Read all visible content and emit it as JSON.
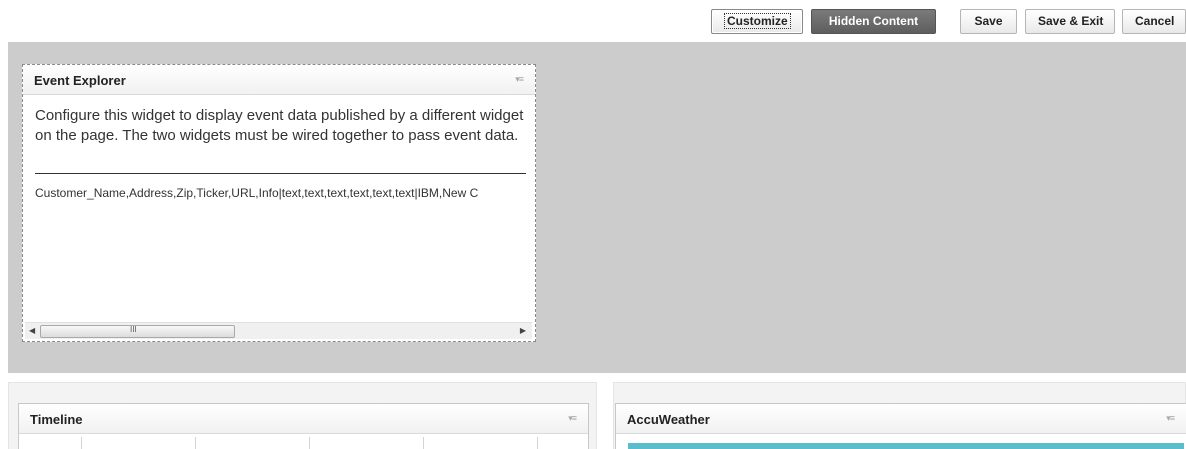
{
  "toolbar": {
    "customize_label": "Customize",
    "hidden_content_label": "Hidden Content",
    "save_label": "Save",
    "save_exit_label": "Save & Exit",
    "cancel_label": "Cancel"
  },
  "widgets": {
    "event_explorer": {
      "title": "Event Explorer",
      "menu_icon": "dropdown-menu-icon",
      "description": "Configure this widget to display event data published by a different widget on the page. The two widgets must be wired together to pass event data.",
      "data_line": "Customer_Name,Address,Zip,Ticker,URL,Info|text,text,text,text,text,text|IBM,New C",
      "scrollbar_grip": "III"
    },
    "timeline": {
      "title": "Timeline",
      "menu_icon": "dropdown-menu-icon"
    },
    "accuweather": {
      "title": "AccuWeather",
      "menu_icon": "dropdown-menu-icon",
      "banner_color": "#5bbccc"
    }
  },
  "colors": {
    "drop_region": "#cccccc",
    "hidden_button": "#6b6b6b"
  }
}
